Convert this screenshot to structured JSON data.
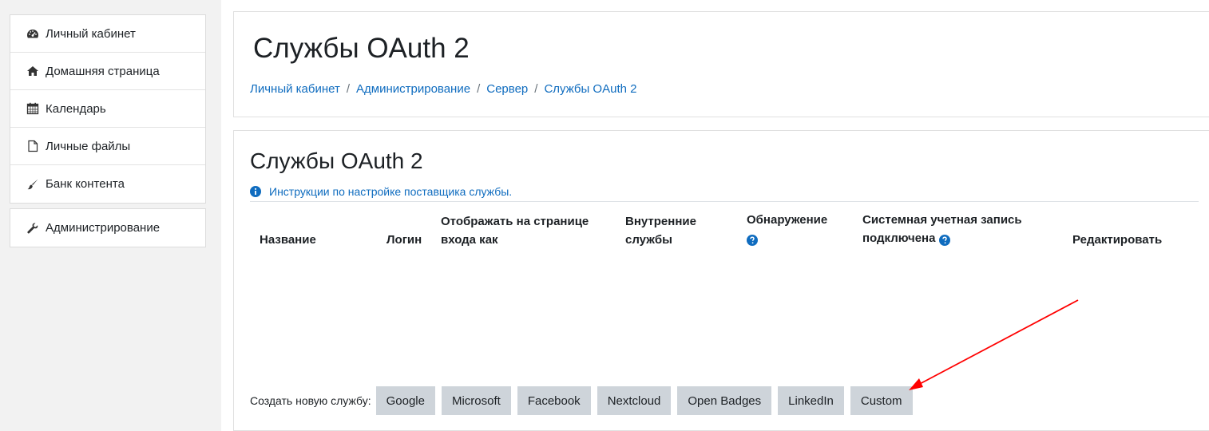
{
  "sidebar": {
    "items": [
      {
        "label": "Личный кабинет",
        "icon": "dashboard-icon"
      },
      {
        "label": "Домашняя страница",
        "icon": "home-icon"
      },
      {
        "label": "Календарь",
        "icon": "calendar-icon"
      },
      {
        "label": "Личные файлы",
        "icon": "file-icon"
      },
      {
        "label": "Банк контента",
        "icon": "brush-icon"
      }
    ],
    "admin": {
      "label": "Администрирование",
      "icon": "wrench-icon"
    }
  },
  "header": {
    "title": "Службы OAuth 2",
    "breadcrumb": [
      "Личный кабинет",
      "Администрирование",
      "Сервер",
      "Службы OAuth 2"
    ],
    "separator": "/"
  },
  "main": {
    "title": "Службы OAuth 2",
    "instructions_link": "Инструкции по настройке поставщика службы.",
    "table": {
      "columns": {
        "name": "Название",
        "login": "Логин",
        "show_on_login_1": "Отображать на странице",
        "show_on_login_2": "входа как",
        "internal_1": "Внутренние",
        "internal_2": "службы",
        "discovery": "Обнаружение",
        "system_account_1": "Системная учетная запись",
        "system_account_2": "подключена",
        "edit": "Редактировать"
      }
    },
    "create_label": "Создать новую службу:",
    "create_buttons": [
      "Google",
      "Microsoft",
      "Facebook",
      "Nextcloud",
      "Open Badges",
      "LinkedIn",
      "Custom"
    ]
  },
  "colors": {
    "link": "#0f6cbf",
    "button_bg": "#ced4da",
    "annotation_arrow": "#ff0000"
  }
}
